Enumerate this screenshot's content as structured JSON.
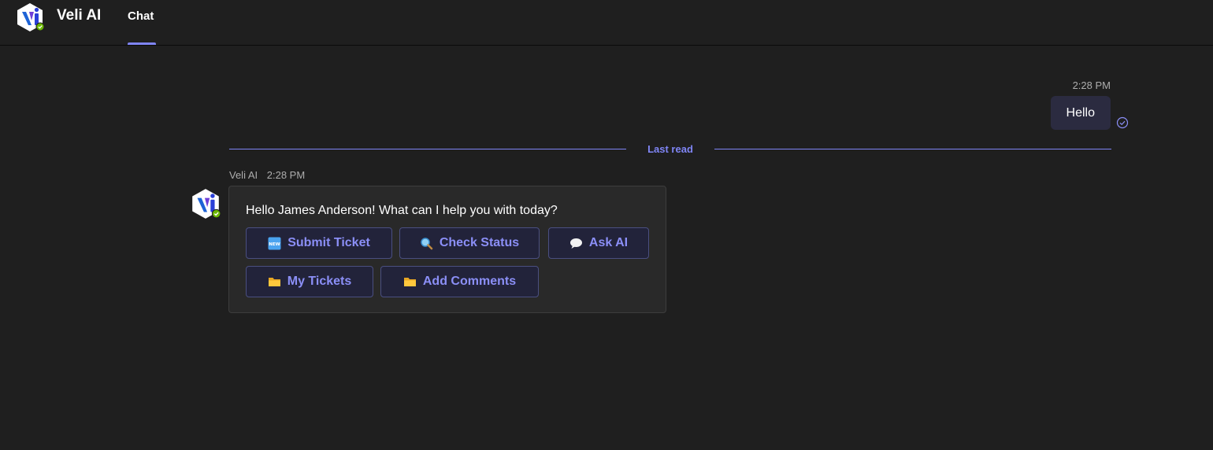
{
  "header": {
    "app_name": "Veli AI",
    "tab_label": "Chat"
  },
  "outgoing_message": {
    "time": "2:28 PM",
    "text": "Hello"
  },
  "divider": {
    "label": "Last read"
  },
  "bot_message": {
    "sender": "Veli AI",
    "time": "2:28 PM",
    "text": "Hello James Anderson! What can I help you with today?",
    "actions": [
      {
        "label": "Submit Ticket",
        "icon": "new-icon"
      },
      {
        "label": "Check Status",
        "icon": "magnifier-icon"
      },
      {
        "label": "Ask AI",
        "icon": "speech-bubble-icon"
      },
      {
        "label": "My Tickets",
        "icon": "folder-icon"
      },
      {
        "label": "Add Comments",
        "icon": "folder-icon"
      }
    ]
  },
  "colors": {
    "accent": "#7f85f5",
    "background": "#1f1f1f",
    "card": "#292929",
    "presence": "#6bb700"
  }
}
